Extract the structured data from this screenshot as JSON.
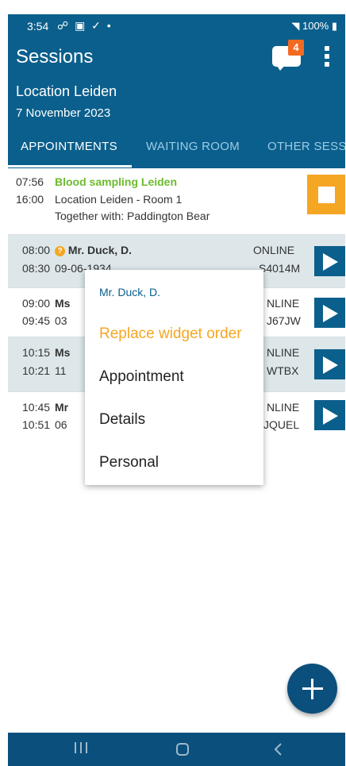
{
  "status_bar": {
    "time": "3:54",
    "left_icons": "☍ ▣ ✓ •",
    "right_text": "100%"
  },
  "header": {
    "title": "Sessions",
    "chat_badge": "4",
    "location": "Location Leiden",
    "date": "7 November 2023"
  },
  "tabs": [
    {
      "label": "APPOINTMENTS",
      "active": true
    },
    {
      "label": "WAITING ROOM",
      "active": false
    },
    {
      "label": "OTHER SESS",
      "active": false
    }
  ],
  "session": {
    "start": "07:56",
    "end": "16:00",
    "title": "Blood sampling Leiden",
    "room": "Location Leiden - Room 1",
    "together": "Together with: Paddington Bear"
  },
  "appointments": [
    {
      "start": "08:00",
      "end": "08:30",
      "name": "Mr. Duck, D.",
      "sub": "09-06-1934",
      "mode": "ONLINE",
      "code": "S4014M",
      "warning": "?"
    },
    {
      "start": "09:00",
      "end": "09:45",
      "name": "Ms",
      "sub": "03",
      "mode": "NLINE",
      "code": "J67JW"
    },
    {
      "start": "10:15",
      "end": "10:21",
      "name": "Ms",
      "sub": "11",
      "mode": "NLINE",
      "code": "WTBX"
    },
    {
      "start": "10:45",
      "end": "10:51",
      "name": "Mr",
      "sub": "06",
      "mode": "NLINE",
      "code": "JQUEL"
    }
  ],
  "menu": {
    "header": "Mr. Duck, D.",
    "items": [
      "Replace widget order",
      "Appointment",
      "Details",
      "Personal"
    ]
  },
  "colors": {
    "primary": "#0b5f8c",
    "accent": "#f5a623",
    "green": "#6cbb2e",
    "badge": "#f26a21"
  }
}
